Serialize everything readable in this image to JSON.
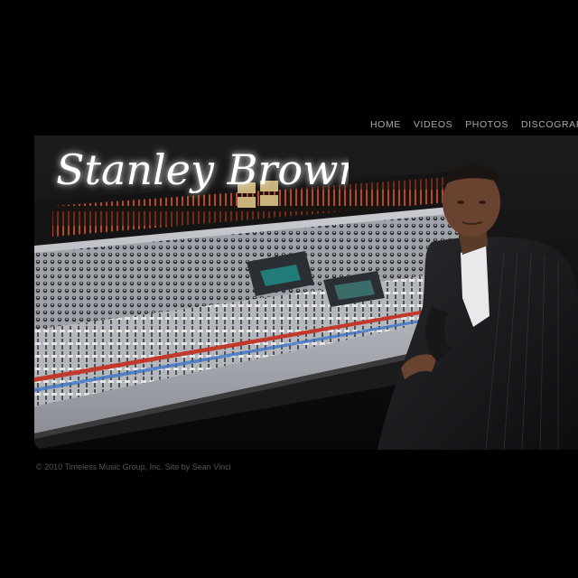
{
  "site": {
    "logo_text": "Stanley Brown"
  },
  "nav": {
    "items": [
      {
        "label": "HOME"
      },
      {
        "label": "VIDEOS"
      },
      {
        "label": "PHOTOS"
      },
      {
        "label": "DISCOGRAPHY"
      }
    ]
  },
  "hero": {
    "alt": "Stanley Brown seated at a large recording studio mixing console"
  },
  "footer": {
    "copyright": "© 2010 Timeless Music Group, Inc.",
    "credit": "Site by Sean Vinci"
  }
}
